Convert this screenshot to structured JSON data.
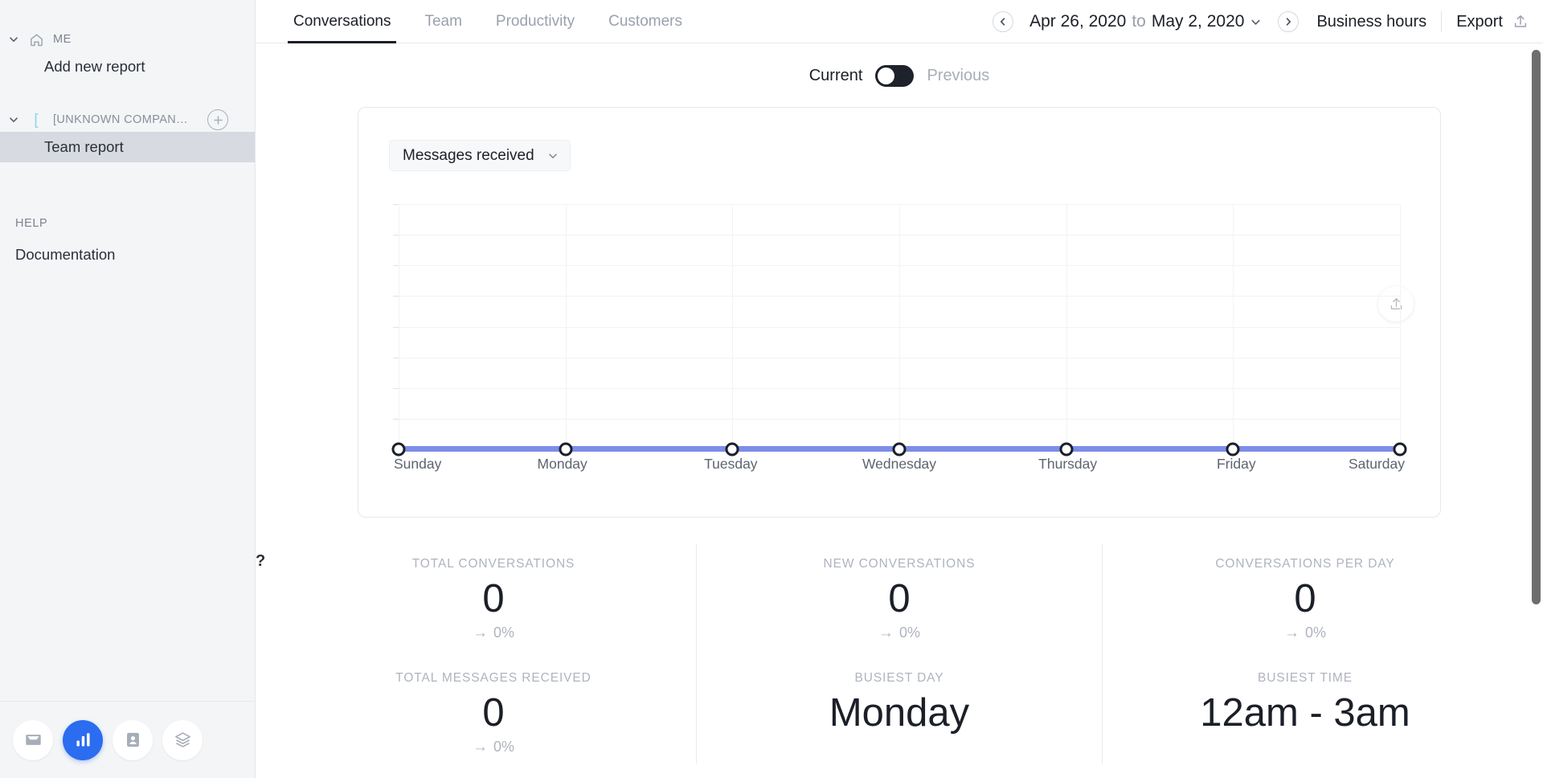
{
  "sidebar": {
    "sections": [
      {
        "id": "me",
        "label": "ME",
        "icon": "home-icon",
        "expanded": true,
        "items": [
          {
            "label": "Add new report",
            "selected": false
          }
        ]
      },
      {
        "id": "company",
        "label": "[UNKNOWN COMPAN…",
        "icon": "bracket-icon",
        "expanded": true,
        "add_label": "+",
        "items": [
          {
            "label": "Team report",
            "selected": true
          }
        ]
      }
    ],
    "help": {
      "heading": "HELP",
      "items": [
        {
          "label": "Documentation"
        }
      ]
    },
    "dock": [
      {
        "name": "inbox-icon",
        "label": "Inbox",
        "active": false
      },
      {
        "name": "analytics-icon",
        "label": "Analytics",
        "active": true
      },
      {
        "name": "contacts-icon",
        "label": "Contacts",
        "active": false
      },
      {
        "name": "layers-icon",
        "label": "Library",
        "active": false
      }
    ]
  },
  "topbar": {
    "tabs": [
      {
        "label": "Conversations",
        "active": true
      },
      {
        "label": "Team",
        "active": false
      },
      {
        "label": "Productivity",
        "active": false
      },
      {
        "label": "Customers",
        "active": false
      }
    ],
    "prev_label": "‹",
    "next_label": "›",
    "date_from": "Apr 26, 2020",
    "date_joiner": "to",
    "date_to": "May 2, 2020",
    "business_hours": "Business hours",
    "export": "Export"
  },
  "compare_toggle": {
    "current_label": "Current",
    "previous_label": "Previous",
    "state": "current"
  },
  "chart_card": {
    "metric_select": "Messages received",
    "upload_icon": "upload-icon"
  },
  "chart_data": {
    "type": "line",
    "title": "Messages received",
    "categories": [
      "Sunday",
      "Monday",
      "Tuesday",
      "Wednesday",
      "Thursday",
      "Friday",
      "Saturday"
    ],
    "values": [
      0,
      0,
      0,
      0,
      0,
      0,
      0
    ],
    "series": [
      {
        "name": "Messages received",
        "values": [
          0,
          0,
          0,
          0,
          0,
          0,
          0
        ],
        "color": "#7d8de8"
      }
    ],
    "xlabel": "",
    "ylabel": "",
    "ylim": [
      0,
      10
    ],
    "grid": true,
    "gridline_count": 9,
    "legend": "none",
    "marker": {
      "fill": "#ffffff",
      "stroke": "#1b1f27"
    }
  },
  "stats": {
    "help_icon": "?",
    "row1": [
      {
        "label": "TOTAL CONVERSATIONS",
        "value": "0",
        "delta": "0%",
        "trend": "flat"
      },
      {
        "label": "NEW CONVERSATIONS",
        "value": "0",
        "delta": "0%",
        "trend": "flat"
      },
      {
        "label": "CONVERSATIONS PER DAY",
        "value": "0",
        "delta": "0%",
        "trend": "flat"
      }
    ],
    "row2": [
      {
        "label": "TOTAL MESSAGES RECEIVED",
        "value": "0",
        "delta": "0%",
        "trend": "flat"
      },
      {
        "label": "BUSIEST DAY",
        "value": "Monday",
        "delta": "",
        "trend": "none"
      },
      {
        "label": "BUSIEST TIME",
        "value": "12am - 3am",
        "delta": "",
        "trend": "none"
      }
    ]
  },
  "colors": {
    "accent": "#2b6cf0",
    "series": "#7d8de8",
    "sidebar_bg": "#f4f5f7",
    "selected_row": "#d7dae0",
    "muted_text": "#9aa1ad"
  }
}
